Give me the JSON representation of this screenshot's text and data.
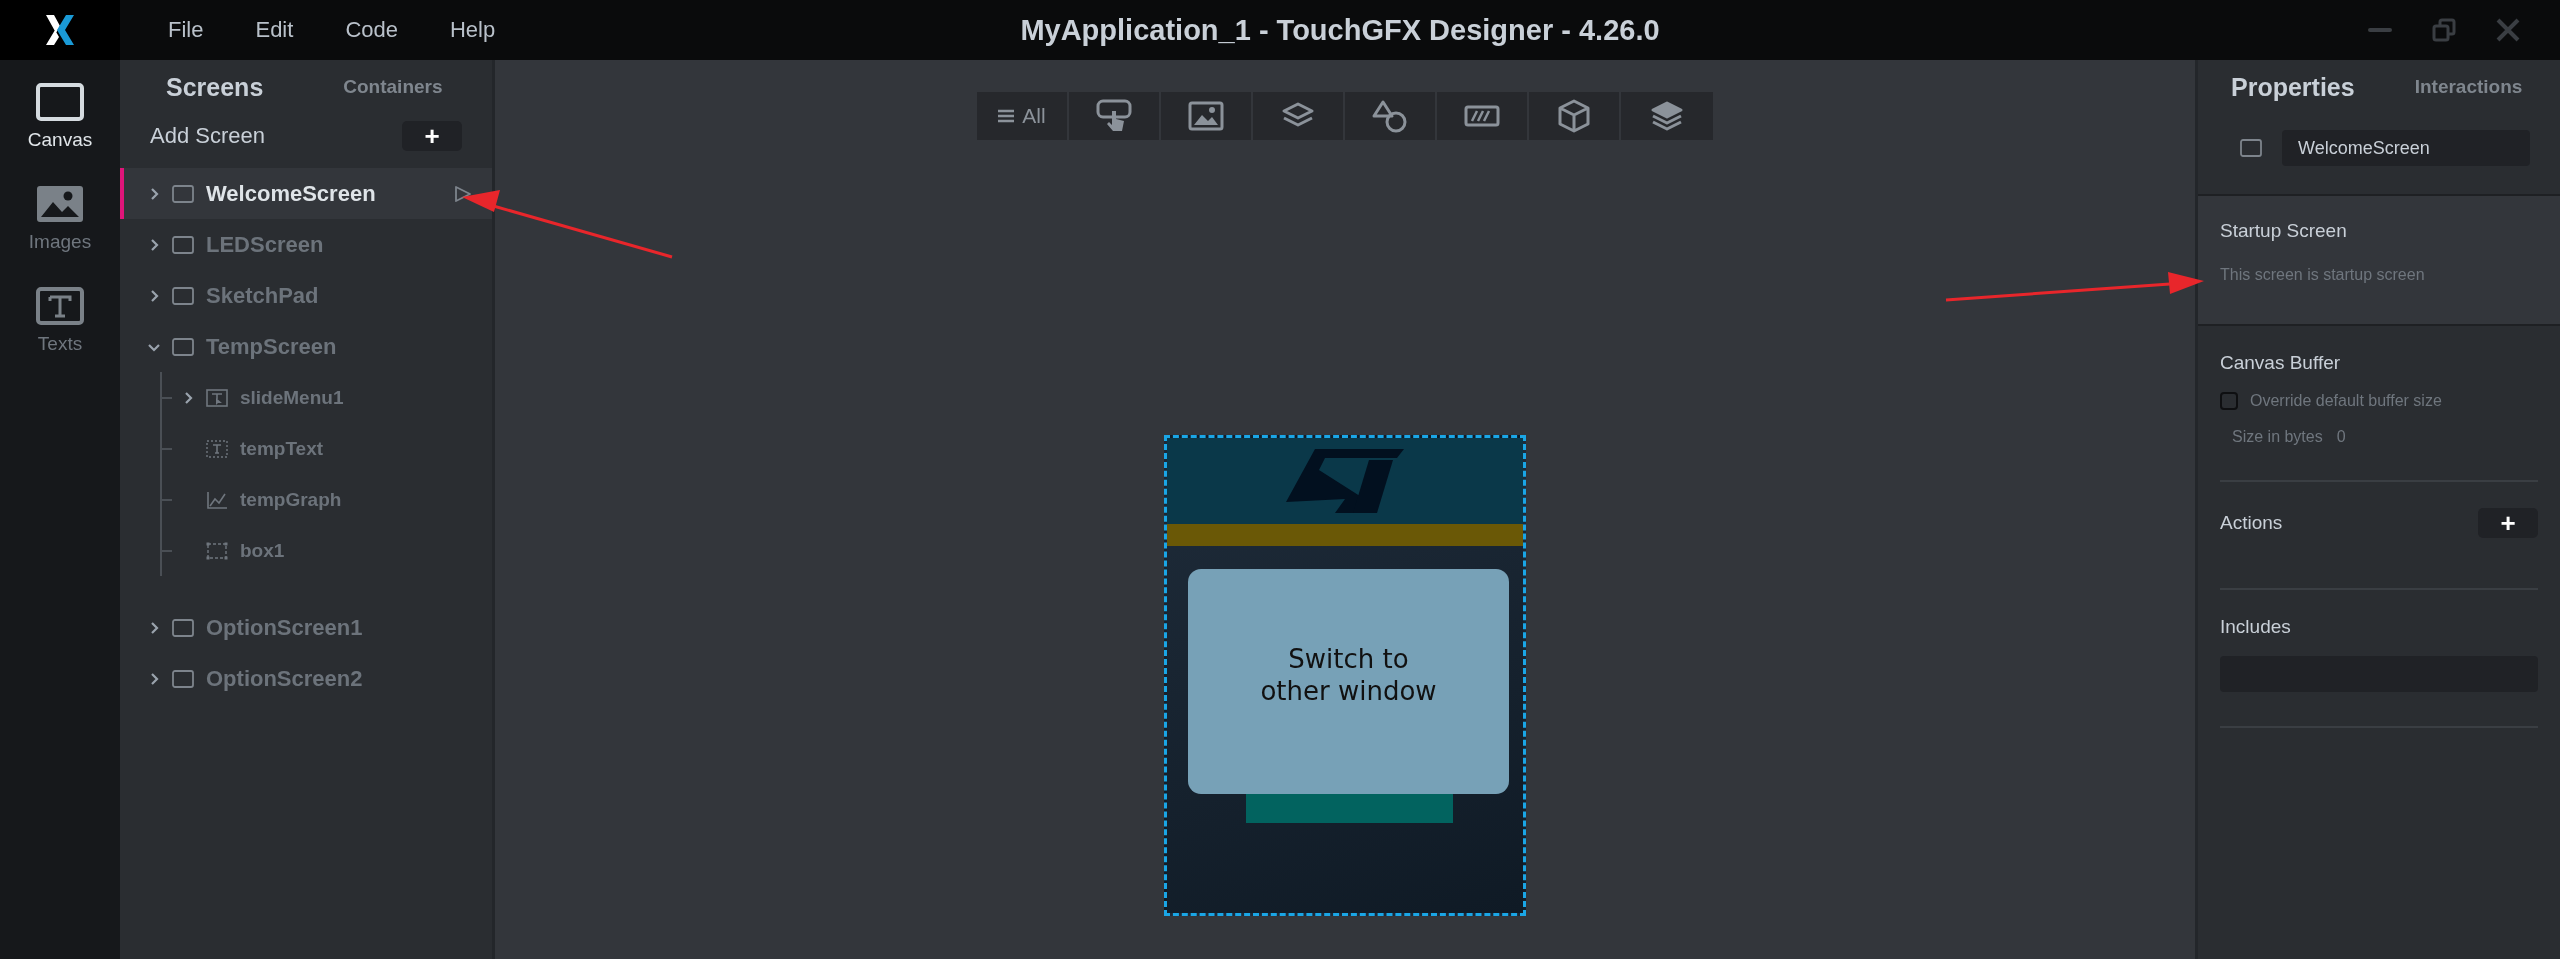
{
  "window": {
    "title": "MyApplication_1 - TouchGFX Designer - 4.26.0"
  },
  "menu": [
    "File",
    "Edit",
    "Code",
    "Help"
  ],
  "rail": [
    {
      "label": "Canvas",
      "kind": "canvas",
      "selected": true
    },
    {
      "label": "Images",
      "kind": "images",
      "selected": false
    },
    {
      "label": "Texts",
      "kind": "texts",
      "selected": false
    }
  ],
  "panel_tabs": [
    {
      "label": "Screens",
      "selected": true
    },
    {
      "label": "Containers",
      "selected": false
    }
  ],
  "add_screen": {
    "label": "Add Screen",
    "button": "+"
  },
  "screens": [
    {
      "name": "WelcomeScreen",
      "expanded": false,
      "selected": true,
      "startup": true
    },
    {
      "name": "LEDScreen",
      "expanded": false,
      "selected": false,
      "startup": false
    },
    {
      "name": "SketchPad",
      "expanded": false,
      "selected": false,
      "startup": false
    },
    {
      "name": "TempScreen",
      "expanded": true,
      "selected": false,
      "startup": false,
      "children": [
        {
          "name": "slideMenu1",
          "kind": "slide-menu",
          "expanded": false
        },
        {
          "name": "tempText",
          "kind": "text"
        },
        {
          "name": "tempGraph",
          "kind": "graph"
        },
        {
          "name": "box1",
          "kind": "box"
        }
      ]
    },
    {
      "name": "OptionScreen1",
      "expanded": false,
      "selected": false,
      "startup": false
    },
    {
      "name": "OptionScreen2",
      "expanded": false,
      "selected": false,
      "startup": false
    }
  ],
  "toolbar": [
    {
      "kind": "all",
      "label": "All"
    },
    {
      "kind": "touch"
    },
    {
      "kind": "image"
    },
    {
      "kind": "layers"
    },
    {
      "kind": "shapes"
    },
    {
      "kind": "progress"
    },
    {
      "kind": "cube"
    },
    {
      "kind": "stack"
    }
  ],
  "device": {
    "popup_text": "Switch to\nother window"
  },
  "properties": {
    "tabs": [
      {
        "label": "Properties",
        "selected": true
      },
      {
        "label": "Interactions",
        "selected": false
      }
    ],
    "name": "WelcomeScreen",
    "startup": {
      "title": "Startup Screen",
      "text": "This screen is startup screen"
    },
    "canvas_buffer": {
      "title": "Canvas Buffer",
      "override_label": "Override default buffer size",
      "checked": false,
      "size_label": "Size in bytes",
      "size_value": "0"
    },
    "actions": {
      "title": "Actions",
      "button": "+"
    },
    "includes": {
      "title": "Includes"
    }
  }
}
